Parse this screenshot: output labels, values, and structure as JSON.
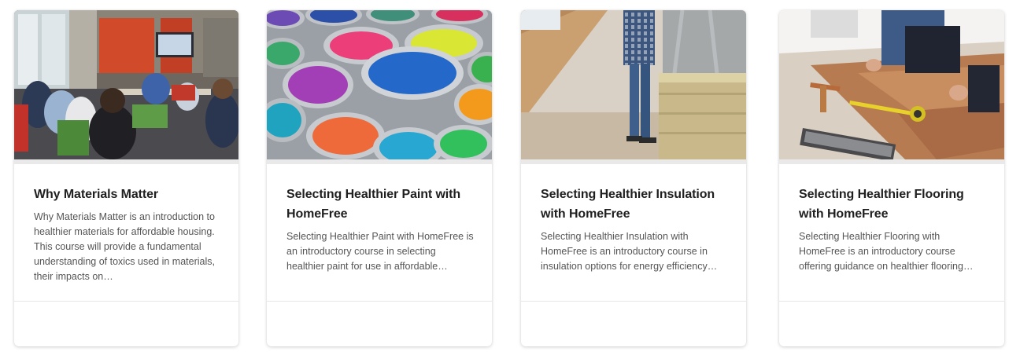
{
  "courses": [
    {
      "image_icon": "classroom-photo",
      "title": "Why Materials Matter",
      "description": "Why Materials Matter is an introduction to healthier materials for affordable housing. This course will provide a fundamental understanding of toxics used in materials, their impacts on…"
    },
    {
      "image_icon": "paint-cans-photo",
      "title": "Selecting Healthier Paint with HomeFree",
      "description": "Selecting Healthier Paint with HomeFree is an introductory course in selecting healthier paint for use in affordable…"
    },
    {
      "image_icon": "insulation-photo",
      "title": "Selecting Healthier Insulation with HomeFree",
      "description": "Selecting Healthier Insulation with HomeFree is an introductory course in insulation options for energy efficiency…"
    },
    {
      "image_icon": "flooring-photo",
      "title": "Selecting Healthier Flooring with HomeFree",
      "description": "Selecting Healthier Flooring with HomeFree is an introductory course offering guidance on healthier flooring…"
    }
  ]
}
